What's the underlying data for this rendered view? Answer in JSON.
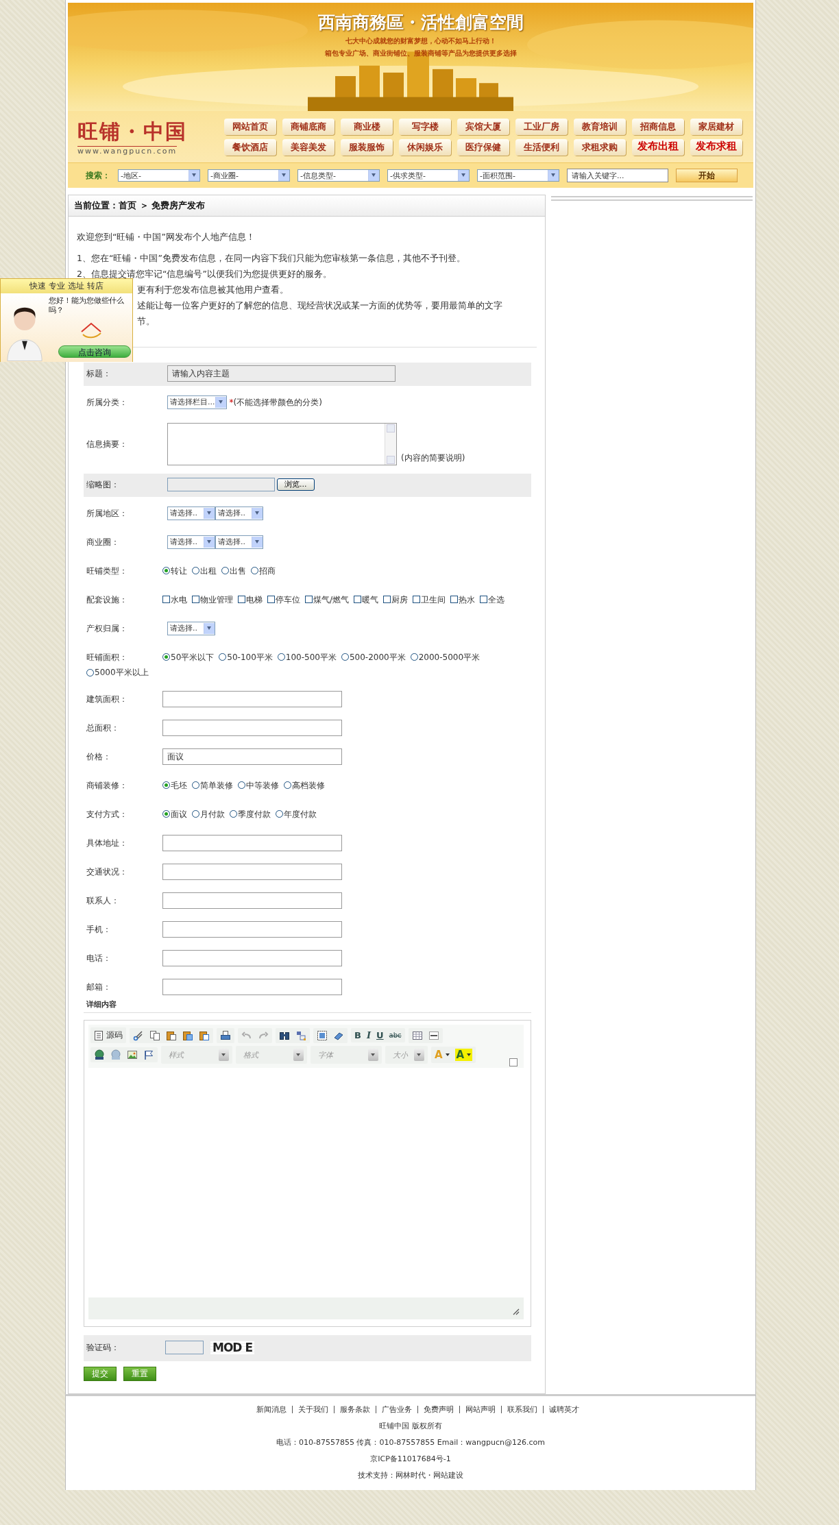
{
  "banner": {
    "headline": "西南商務區・活性創富空間",
    "lines": [
      "七大中心成就您的财富梦想，心动不如马上行动！",
      "箱包专业广场、商业街铺位、服装商铺等产品为您提供更多选择"
    ]
  },
  "logo": {
    "name": "旺铺・中国",
    "url": "www.wangpucn.com"
  },
  "nav": [
    {
      "label": "网站首页",
      "highlight": false
    },
    {
      "label": "商铺底商",
      "highlight": false
    },
    {
      "label": "商业楼",
      "highlight": false
    },
    {
      "label": "写字楼",
      "highlight": false
    },
    {
      "label": "宾馆大厦",
      "highlight": false
    },
    {
      "label": "工业厂房",
      "highlight": false
    },
    {
      "label": "教育培训",
      "highlight": false
    },
    {
      "label": "招商信息",
      "highlight": false
    },
    {
      "label": "家居建材",
      "highlight": false
    },
    {
      "label": "餐饮酒店",
      "highlight": false
    },
    {
      "label": "美容美发",
      "highlight": false
    },
    {
      "label": "服装服饰",
      "highlight": false
    },
    {
      "label": "休闲娱乐",
      "highlight": false
    },
    {
      "label": "医疗保健",
      "highlight": false
    },
    {
      "label": "生活便利",
      "highlight": false
    },
    {
      "label": "求租求购",
      "highlight": false
    },
    {
      "label": "发布出租",
      "highlight": true
    },
    {
      "label": "发布求租",
      "highlight": true
    }
  ],
  "search": {
    "label": "搜索：",
    "filters": [
      "-地区-",
      "-商业圈-",
      "-信息类型-",
      "-供求类型-",
      "-面积范围-"
    ],
    "keyword": "请输入关键字...",
    "button": "开始"
  },
  "breadcrumb": "当前位置：首页 ＞ 免费房产发布",
  "intro": {
    "welcome": "欢迎您到“旺铺・中国”网发布个人地产信息！",
    "notes": [
      "1、您在“旺铺・中国”免费发布信息，在同一内容下我们只能为您审核第一条信息，其他不予刊登。",
      "2、信息提交请您牢记“信息编号”以便我们为您提供更好的服务。"
    ],
    "partial_notes": [
      "更有利于您发布信息被其他用户查看。",
      "述能让每一位客户更好的了解您的信息、现经营状况或某一方面的优势等，要用最简单的文字",
      "节。"
    ]
  },
  "consult_widget": {
    "title": "快速 专业 选址 转店",
    "greeting": "您好！能为您做些什么吗？",
    "button": "点击咨询"
  },
  "form": {
    "rows": [
      {
        "kind": "wide-text",
        "label": "标题：",
        "value": "请输入内容主题",
        "shaded": true
      },
      {
        "kind": "select",
        "label": "所属分类：",
        "selects": [
          "请选择栏目..."
        ],
        "marker": "*",
        "note": "(不能选择带颜色的分类)",
        "shaded": false
      },
      {
        "kind": "textarea",
        "label": "信息摘要：",
        "note": "(内容的简要说明)",
        "shaded": false
      },
      {
        "kind": "file",
        "label": "缩略图：",
        "button": "浏览...",
        "shaded": true
      },
      {
        "kind": "select",
        "label": "所属地区：",
        "selects": [
          "请选择..",
          "请选择.."
        ],
        "shaded": false
      },
      {
        "kind": "select",
        "label": "商业圈：",
        "selects": [
          "请选择..",
          "请选择.."
        ],
        "shaded": false
      },
      {
        "kind": "radio",
        "label": "旺铺类型：",
        "options": [
          {
            "label": "转让",
            "selected": true
          },
          {
            "label": "出租",
            "selected": false
          },
          {
            "label": "出售",
            "selected": false
          },
          {
            "label": "招商",
            "selected": false
          }
        ],
        "shaded": false
      },
      {
        "kind": "checkbox",
        "label": "配套设施：",
        "options": [
          {
            "label": "水电",
            "checked": false
          },
          {
            "label": "物业管理",
            "checked": false
          },
          {
            "label": "电梯",
            "checked": false
          },
          {
            "label": "停车位",
            "checked": false
          },
          {
            "label": "煤气/燃气",
            "checked": false
          },
          {
            "label": "暖气",
            "checked": false
          },
          {
            "label": "厨房",
            "checked": false
          },
          {
            "label": "卫生间",
            "checked": false
          },
          {
            "label": "热水",
            "checked": false
          },
          {
            "label": "全选",
            "checked": false
          }
        ],
        "shaded": false
      },
      {
        "kind": "select",
        "label": "产权归属：",
        "selects": [
          "请选择.."
        ],
        "shaded": false
      },
      {
        "kind": "radio",
        "label": "旺铺面积：",
        "options": [
          {
            "label": "50平米以下",
            "selected": true
          },
          {
            "label": "50-100平米",
            "selected": false
          },
          {
            "label": "100-500平米",
            "selected": false
          },
          {
            "label": "500-2000平米",
            "selected": false
          },
          {
            "label": "2000-5000平米",
            "selected": false
          },
          {
            "label": "5000平米以上",
            "selected": false
          }
        ],
        "shaded": false
      },
      {
        "kind": "text",
        "label": "建筑面积：",
        "value": "",
        "shaded": false
      },
      {
        "kind": "text",
        "label": "总面积：",
        "value": "",
        "shaded": false
      },
      {
        "kind": "text",
        "label": "价格：",
        "value": "面议",
        "shaded": false
      },
      {
        "kind": "radio",
        "label": "商铺装修：",
        "options": [
          {
            "label": "毛坯",
            "selected": true
          },
          {
            "label": "简单装修",
            "selected": false
          },
          {
            "label": "中等装修",
            "selected": false
          },
          {
            "label": "高档装修",
            "selected": false
          }
        ],
        "shaded": false
      },
      {
        "kind": "radio",
        "label": "支付方式：",
        "options": [
          {
            "label": "面议",
            "selected": true
          },
          {
            "label": "月付款",
            "selected": false
          },
          {
            "label": "季度付款",
            "selected": false
          },
          {
            "label": "年度付款",
            "selected": false
          }
        ],
        "shaded": false
      },
      {
        "kind": "text",
        "label": "具体地址：",
        "value": "",
        "shaded": false
      },
      {
        "kind": "text",
        "label": "交通状况：",
        "value": "",
        "shaded": false
      },
      {
        "kind": "text",
        "label": "联系人：",
        "value": "",
        "shaded": false
      },
      {
        "kind": "text",
        "label": "手机：",
        "value": "",
        "shaded": false
      },
      {
        "kind": "text",
        "label": "电话：",
        "value": "",
        "shaded": false
      },
      {
        "kind": "text",
        "label": "邮箱：",
        "value": "",
        "shaded": false
      }
    ],
    "detail_heading": "详细内容",
    "editor": {
      "source_button": "源码",
      "format_buttons": [
        "B",
        "I",
        "U",
        "abc"
      ],
      "dropdowns": [
        "样式",
        "格式",
        "字体",
        "大小"
      ],
      "color_buttons": [
        "A",
        "A"
      ]
    },
    "captcha": {
      "label": "验证码：",
      "code": "MOD E"
    },
    "buttons": [
      "提交",
      "重置"
    ]
  },
  "footer": {
    "links": [
      "新闻消息",
      "关于我们",
      "服务条款",
      "广告业务",
      "免费声明",
      "网站声明",
      "联系我们",
      "诚聘英才"
    ],
    "lines": [
      "旺铺中国 版权所有",
      "电话：010-87557855 传真：010-87557855  Email：wangpucn@126.com",
      "京ICP备11017684号-1",
      "技术支持：网林时代・网站建设"
    ]
  }
}
